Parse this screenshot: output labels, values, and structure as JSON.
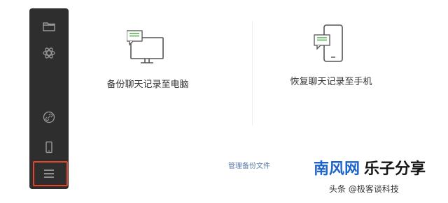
{
  "sidebar": {
    "icons": [
      "folder-icon",
      "settings-icon",
      "link-icon",
      "phone-icon",
      "menu-icon"
    ]
  },
  "main": {
    "backup_to_pc_label": "备份聊天记录至电脑",
    "restore_to_phone_label": "恢复聊天记录至手机",
    "manage_backup_link": "管理备份文件"
  },
  "watermark": {
    "brand_part1": "南风网",
    "brand_part2": "乐子分享",
    "credit": "头条 @极客谈科技"
  },
  "colors": {
    "sidebar_bg": "#2e2e2e",
    "highlight": "#e2462a",
    "icon_green": "#7ec27a",
    "link_blue": "#5b79a8",
    "brand_blue": "#1e63c9"
  }
}
